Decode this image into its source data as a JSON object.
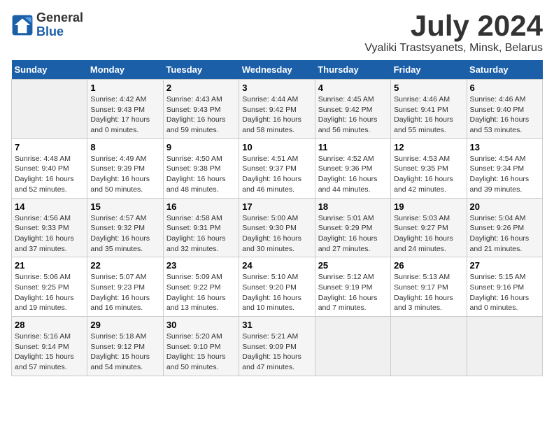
{
  "logo": {
    "general": "General",
    "blue": "Blue"
  },
  "title": "July 2024",
  "subtitle": "Vyaliki Trastsyanets, Minsk, Belarus",
  "days_of_week": [
    "Sunday",
    "Monday",
    "Tuesday",
    "Wednesday",
    "Thursday",
    "Friday",
    "Saturday"
  ],
  "weeks": [
    [
      {
        "day": "",
        "info": ""
      },
      {
        "day": "1",
        "info": "Sunrise: 4:42 AM\nSunset: 9:43 PM\nDaylight: 17 hours\nand 0 minutes."
      },
      {
        "day": "2",
        "info": "Sunrise: 4:43 AM\nSunset: 9:43 PM\nDaylight: 16 hours\nand 59 minutes."
      },
      {
        "day": "3",
        "info": "Sunrise: 4:44 AM\nSunset: 9:42 PM\nDaylight: 16 hours\nand 58 minutes."
      },
      {
        "day": "4",
        "info": "Sunrise: 4:45 AM\nSunset: 9:42 PM\nDaylight: 16 hours\nand 56 minutes."
      },
      {
        "day": "5",
        "info": "Sunrise: 4:46 AM\nSunset: 9:41 PM\nDaylight: 16 hours\nand 55 minutes."
      },
      {
        "day": "6",
        "info": "Sunrise: 4:46 AM\nSunset: 9:40 PM\nDaylight: 16 hours\nand 53 minutes."
      }
    ],
    [
      {
        "day": "7",
        "info": "Sunrise: 4:48 AM\nSunset: 9:40 PM\nDaylight: 16 hours\nand 52 minutes."
      },
      {
        "day": "8",
        "info": "Sunrise: 4:49 AM\nSunset: 9:39 PM\nDaylight: 16 hours\nand 50 minutes."
      },
      {
        "day": "9",
        "info": "Sunrise: 4:50 AM\nSunset: 9:38 PM\nDaylight: 16 hours\nand 48 minutes."
      },
      {
        "day": "10",
        "info": "Sunrise: 4:51 AM\nSunset: 9:37 PM\nDaylight: 16 hours\nand 46 minutes."
      },
      {
        "day": "11",
        "info": "Sunrise: 4:52 AM\nSunset: 9:36 PM\nDaylight: 16 hours\nand 44 minutes."
      },
      {
        "day": "12",
        "info": "Sunrise: 4:53 AM\nSunset: 9:35 PM\nDaylight: 16 hours\nand 42 minutes."
      },
      {
        "day": "13",
        "info": "Sunrise: 4:54 AM\nSunset: 9:34 PM\nDaylight: 16 hours\nand 39 minutes."
      }
    ],
    [
      {
        "day": "14",
        "info": "Sunrise: 4:56 AM\nSunset: 9:33 PM\nDaylight: 16 hours\nand 37 minutes."
      },
      {
        "day": "15",
        "info": "Sunrise: 4:57 AM\nSunset: 9:32 PM\nDaylight: 16 hours\nand 35 minutes."
      },
      {
        "day": "16",
        "info": "Sunrise: 4:58 AM\nSunset: 9:31 PM\nDaylight: 16 hours\nand 32 minutes."
      },
      {
        "day": "17",
        "info": "Sunrise: 5:00 AM\nSunset: 9:30 PM\nDaylight: 16 hours\nand 30 minutes."
      },
      {
        "day": "18",
        "info": "Sunrise: 5:01 AM\nSunset: 9:29 PM\nDaylight: 16 hours\nand 27 minutes."
      },
      {
        "day": "19",
        "info": "Sunrise: 5:03 AM\nSunset: 9:27 PM\nDaylight: 16 hours\nand 24 minutes."
      },
      {
        "day": "20",
        "info": "Sunrise: 5:04 AM\nSunset: 9:26 PM\nDaylight: 16 hours\nand 21 minutes."
      }
    ],
    [
      {
        "day": "21",
        "info": "Sunrise: 5:06 AM\nSunset: 9:25 PM\nDaylight: 16 hours\nand 19 minutes."
      },
      {
        "day": "22",
        "info": "Sunrise: 5:07 AM\nSunset: 9:23 PM\nDaylight: 16 hours\nand 16 minutes."
      },
      {
        "day": "23",
        "info": "Sunrise: 5:09 AM\nSunset: 9:22 PM\nDaylight: 16 hours\nand 13 minutes."
      },
      {
        "day": "24",
        "info": "Sunrise: 5:10 AM\nSunset: 9:20 PM\nDaylight: 16 hours\nand 10 minutes."
      },
      {
        "day": "25",
        "info": "Sunrise: 5:12 AM\nSunset: 9:19 PM\nDaylight: 16 hours\nand 7 minutes."
      },
      {
        "day": "26",
        "info": "Sunrise: 5:13 AM\nSunset: 9:17 PM\nDaylight: 16 hours\nand 3 minutes."
      },
      {
        "day": "27",
        "info": "Sunrise: 5:15 AM\nSunset: 9:16 PM\nDaylight: 16 hours\nand 0 minutes."
      }
    ],
    [
      {
        "day": "28",
        "info": "Sunrise: 5:16 AM\nSunset: 9:14 PM\nDaylight: 15 hours\nand 57 minutes."
      },
      {
        "day": "29",
        "info": "Sunrise: 5:18 AM\nSunset: 9:12 PM\nDaylight: 15 hours\nand 54 minutes."
      },
      {
        "day": "30",
        "info": "Sunrise: 5:20 AM\nSunset: 9:10 PM\nDaylight: 15 hours\nand 50 minutes."
      },
      {
        "day": "31",
        "info": "Sunrise: 5:21 AM\nSunset: 9:09 PM\nDaylight: 15 hours\nand 47 minutes."
      },
      {
        "day": "",
        "info": ""
      },
      {
        "day": "",
        "info": ""
      },
      {
        "day": "",
        "info": ""
      }
    ]
  ]
}
